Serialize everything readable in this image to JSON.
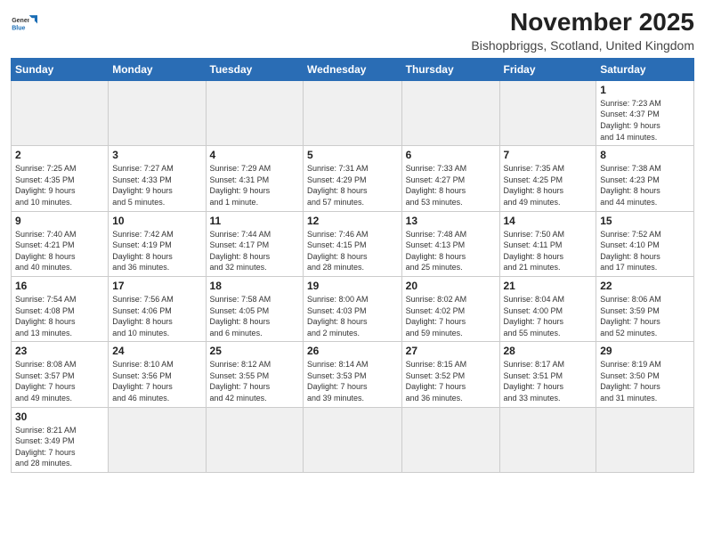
{
  "header": {
    "logo_general": "General",
    "logo_blue": "Blue",
    "month": "November 2025",
    "location": "Bishopbriggs, Scotland, United Kingdom"
  },
  "weekdays": [
    "Sunday",
    "Monday",
    "Tuesday",
    "Wednesday",
    "Thursday",
    "Friday",
    "Saturday"
  ],
  "weeks": [
    [
      {
        "day": "",
        "info": ""
      },
      {
        "day": "",
        "info": ""
      },
      {
        "day": "",
        "info": ""
      },
      {
        "day": "",
        "info": ""
      },
      {
        "day": "",
        "info": ""
      },
      {
        "day": "",
        "info": ""
      },
      {
        "day": "1",
        "info": "Sunrise: 7:23 AM\nSunset: 4:37 PM\nDaylight: 9 hours\nand 14 minutes."
      }
    ],
    [
      {
        "day": "2",
        "info": "Sunrise: 7:25 AM\nSunset: 4:35 PM\nDaylight: 9 hours\nand 10 minutes."
      },
      {
        "day": "3",
        "info": "Sunrise: 7:27 AM\nSunset: 4:33 PM\nDaylight: 9 hours\nand 5 minutes."
      },
      {
        "day": "4",
        "info": "Sunrise: 7:29 AM\nSunset: 4:31 PM\nDaylight: 9 hours\nand 1 minute."
      },
      {
        "day": "5",
        "info": "Sunrise: 7:31 AM\nSunset: 4:29 PM\nDaylight: 8 hours\nand 57 minutes."
      },
      {
        "day": "6",
        "info": "Sunrise: 7:33 AM\nSunset: 4:27 PM\nDaylight: 8 hours\nand 53 minutes."
      },
      {
        "day": "7",
        "info": "Sunrise: 7:35 AM\nSunset: 4:25 PM\nDaylight: 8 hours\nand 49 minutes."
      },
      {
        "day": "8",
        "info": "Sunrise: 7:38 AM\nSunset: 4:23 PM\nDaylight: 8 hours\nand 44 minutes."
      }
    ],
    [
      {
        "day": "9",
        "info": "Sunrise: 7:40 AM\nSunset: 4:21 PM\nDaylight: 8 hours\nand 40 minutes."
      },
      {
        "day": "10",
        "info": "Sunrise: 7:42 AM\nSunset: 4:19 PM\nDaylight: 8 hours\nand 36 minutes."
      },
      {
        "day": "11",
        "info": "Sunrise: 7:44 AM\nSunset: 4:17 PM\nDaylight: 8 hours\nand 32 minutes."
      },
      {
        "day": "12",
        "info": "Sunrise: 7:46 AM\nSunset: 4:15 PM\nDaylight: 8 hours\nand 28 minutes."
      },
      {
        "day": "13",
        "info": "Sunrise: 7:48 AM\nSunset: 4:13 PM\nDaylight: 8 hours\nand 25 minutes."
      },
      {
        "day": "14",
        "info": "Sunrise: 7:50 AM\nSunset: 4:11 PM\nDaylight: 8 hours\nand 21 minutes."
      },
      {
        "day": "15",
        "info": "Sunrise: 7:52 AM\nSunset: 4:10 PM\nDaylight: 8 hours\nand 17 minutes."
      }
    ],
    [
      {
        "day": "16",
        "info": "Sunrise: 7:54 AM\nSunset: 4:08 PM\nDaylight: 8 hours\nand 13 minutes."
      },
      {
        "day": "17",
        "info": "Sunrise: 7:56 AM\nSunset: 4:06 PM\nDaylight: 8 hours\nand 10 minutes."
      },
      {
        "day": "18",
        "info": "Sunrise: 7:58 AM\nSunset: 4:05 PM\nDaylight: 8 hours\nand 6 minutes."
      },
      {
        "day": "19",
        "info": "Sunrise: 8:00 AM\nSunset: 4:03 PM\nDaylight: 8 hours\nand 2 minutes."
      },
      {
        "day": "20",
        "info": "Sunrise: 8:02 AM\nSunset: 4:02 PM\nDaylight: 7 hours\nand 59 minutes."
      },
      {
        "day": "21",
        "info": "Sunrise: 8:04 AM\nSunset: 4:00 PM\nDaylight: 7 hours\nand 55 minutes."
      },
      {
        "day": "22",
        "info": "Sunrise: 8:06 AM\nSunset: 3:59 PM\nDaylight: 7 hours\nand 52 minutes."
      }
    ],
    [
      {
        "day": "23",
        "info": "Sunrise: 8:08 AM\nSunset: 3:57 PM\nDaylight: 7 hours\nand 49 minutes."
      },
      {
        "day": "24",
        "info": "Sunrise: 8:10 AM\nSunset: 3:56 PM\nDaylight: 7 hours\nand 46 minutes."
      },
      {
        "day": "25",
        "info": "Sunrise: 8:12 AM\nSunset: 3:55 PM\nDaylight: 7 hours\nand 42 minutes."
      },
      {
        "day": "26",
        "info": "Sunrise: 8:14 AM\nSunset: 3:53 PM\nDaylight: 7 hours\nand 39 minutes."
      },
      {
        "day": "27",
        "info": "Sunrise: 8:15 AM\nSunset: 3:52 PM\nDaylight: 7 hours\nand 36 minutes."
      },
      {
        "day": "28",
        "info": "Sunrise: 8:17 AM\nSunset: 3:51 PM\nDaylight: 7 hours\nand 33 minutes."
      },
      {
        "day": "29",
        "info": "Sunrise: 8:19 AM\nSunset: 3:50 PM\nDaylight: 7 hours\nand 31 minutes."
      }
    ],
    [
      {
        "day": "30",
        "info": "Sunrise: 8:21 AM\nSunset: 3:49 PM\nDaylight: 7 hours\nand 28 minutes."
      },
      {
        "day": "",
        "info": ""
      },
      {
        "day": "",
        "info": ""
      },
      {
        "day": "",
        "info": ""
      },
      {
        "day": "",
        "info": ""
      },
      {
        "day": "",
        "info": ""
      },
      {
        "day": "",
        "info": ""
      }
    ]
  ]
}
